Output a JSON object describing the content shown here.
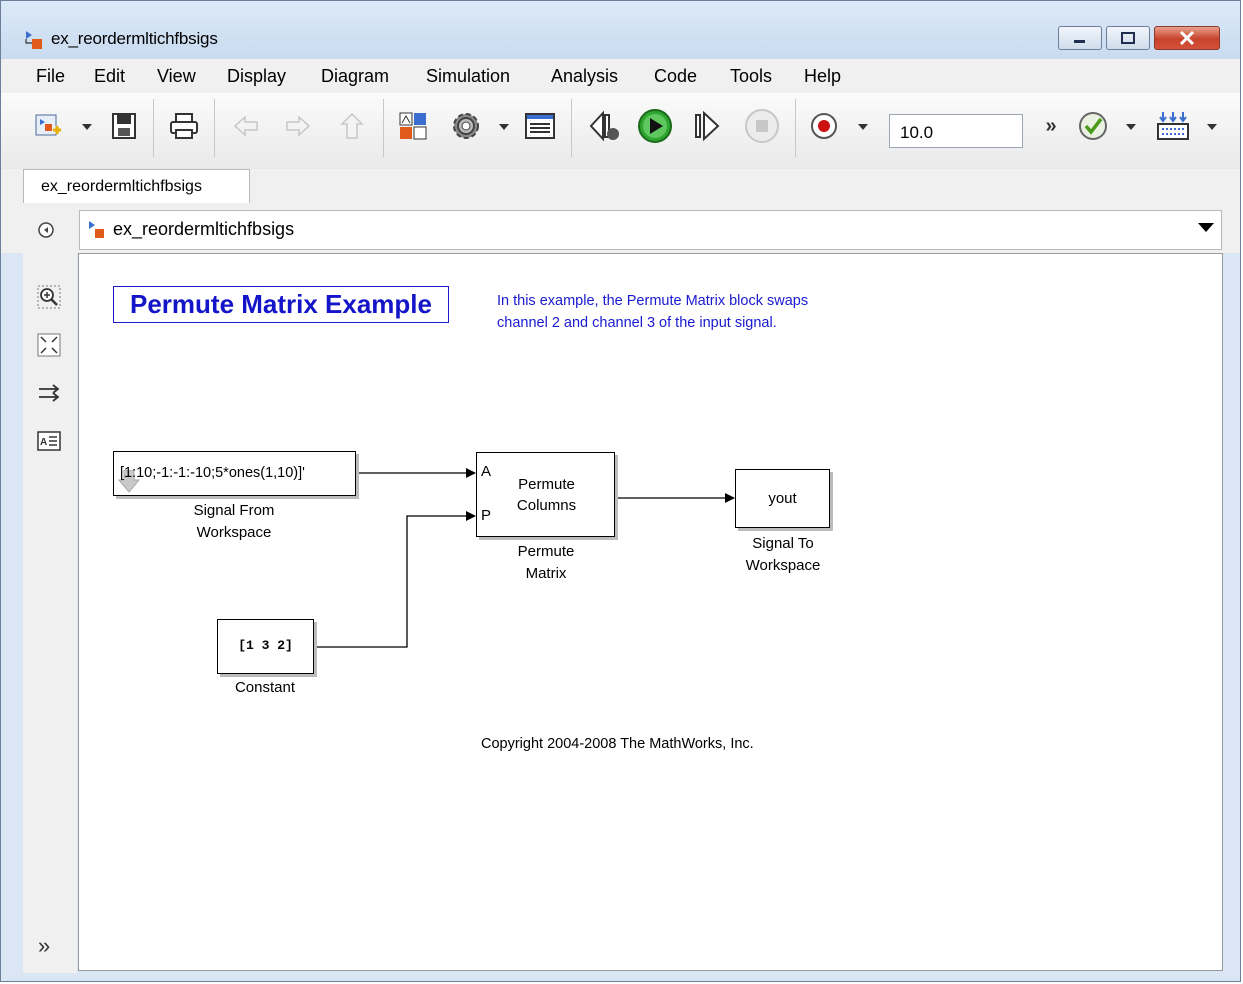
{
  "window": {
    "title": "ex_reordermltichfbsigs"
  },
  "menubar": {
    "items": [
      "File",
      "Edit",
      "View",
      "Display",
      "Diagram",
      "Simulation",
      "Analysis",
      "Code",
      "Tools",
      "Help"
    ]
  },
  "toolbar": {
    "stop_time": "10.0",
    "overflow_label": "»",
    "icons": [
      "new-model-icon",
      "save-icon",
      "print-icon",
      "back-icon",
      "forward-icon",
      "up-icon",
      "library-browser-icon",
      "settings-gear-icon",
      "model-explorer-icon",
      "step-back-icon",
      "run-icon",
      "step-forward-icon",
      "stop-icon",
      "record-icon",
      "check-icon",
      "build-icon"
    ]
  },
  "tab": {
    "label": "ex_reordermltichfbsigs"
  },
  "address": {
    "path": "ex_reordermltichfbsigs"
  },
  "palette": {
    "bottom_label": "»"
  },
  "canvas": {
    "title": "Permute Matrix Example",
    "description": "In this example, the Permute Matrix block swaps channel 2 and channel 3 of the input signal.",
    "copyright": "Copyright 2004-2008 The MathWorks, Inc.",
    "blocks": {
      "signal_from_workspace": {
        "text": "[1:10;-1:-1:-10;5*ones(1,10)]'",
        "label_line1": "Signal From",
        "label_line2": "Workspace"
      },
      "permute_matrix": {
        "port_a": "A",
        "port_p": "P",
        "text_line1": "Permute",
        "text_line2": "Columns",
        "label_line1": "Permute",
        "label_line2": "Matrix"
      },
      "signal_to_workspace": {
        "text": "yout",
        "label_line1": "Signal To",
        "label_line2": "Workspace"
      },
      "constant": {
        "text": "[1 3 2]",
        "label": "Constant"
      }
    }
  },
  "colors": {
    "annotation_blue": "#1414c8",
    "run_green": "#2fa52f",
    "record_red": "#cc1111"
  }
}
